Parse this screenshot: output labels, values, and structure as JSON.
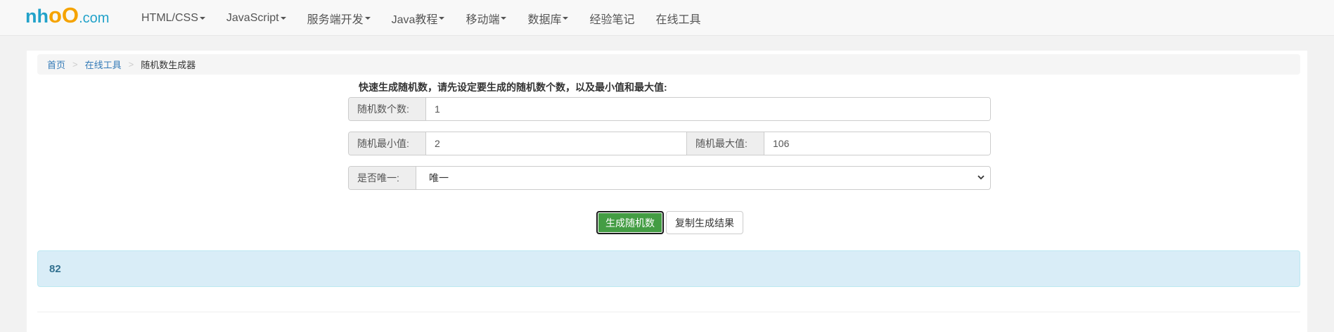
{
  "navbar": {
    "logo": {
      "part1": "nh",
      "part2": "oO",
      "part3": ".com"
    },
    "items": [
      {
        "label": "HTML/CSS",
        "dropdown": true
      },
      {
        "label": "JavaScript",
        "dropdown": true
      },
      {
        "label": "服务端开发",
        "dropdown": true
      },
      {
        "label": "Java教程",
        "dropdown": true
      },
      {
        "label": "移动端",
        "dropdown": true
      },
      {
        "label": "数据库",
        "dropdown": true
      },
      {
        "label": "经验笔记",
        "dropdown": false
      },
      {
        "label": "在线工具",
        "dropdown": false
      }
    ]
  },
  "breadcrumb": {
    "home": "首页",
    "tools": "在线工具",
    "current": "随机数生成器",
    "separator": ">"
  },
  "form": {
    "intro": "快速生成随机数，请先设定要生成的随机数个数，以及最小值和最大值:",
    "count_label": "随机数个数:",
    "count_value": "1",
    "min_label": "随机最小值:",
    "min_value": "2",
    "max_label": "随机最大值:",
    "max_value": "106",
    "unique_label": "是否唯一:",
    "unique_value": "唯一"
  },
  "buttons": {
    "generate": "生成随机数",
    "copy": "复制生成结果"
  },
  "result": {
    "value": "82"
  },
  "colors": {
    "brand_blue": "#22a2c9",
    "brand_orange": "#f5a300",
    "link": "#337ab7",
    "success": "#449d44",
    "info_bg": "#d9edf7",
    "info_text": "#31708f"
  }
}
